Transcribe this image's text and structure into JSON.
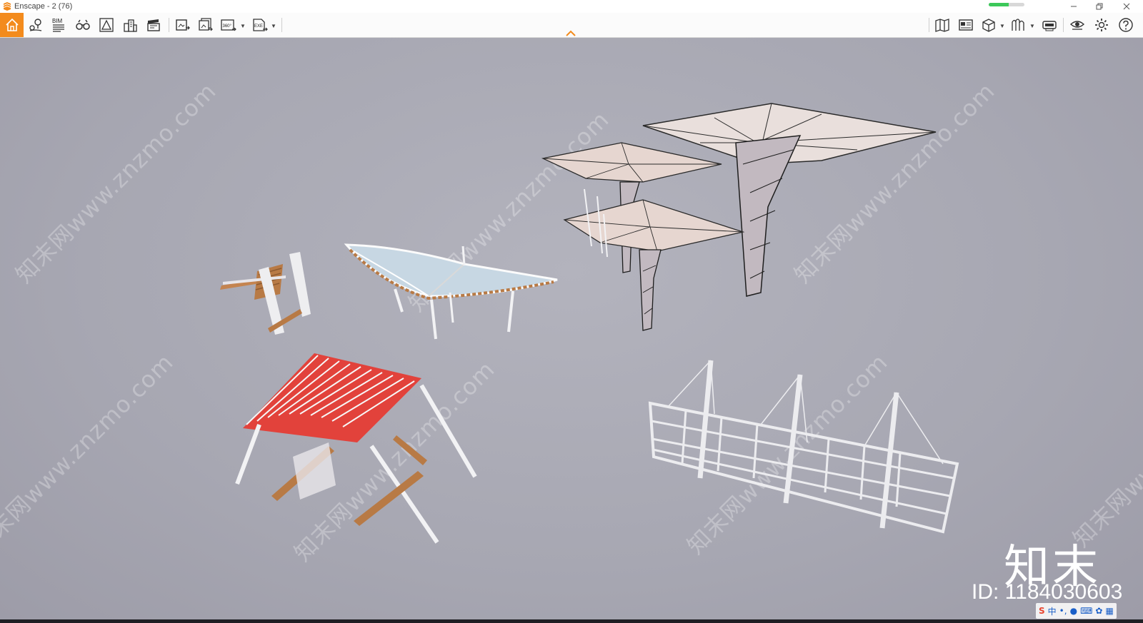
{
  "window": {
    "title": "Enscape - 2 (76)",
    "loading_progress": 0.55,
    "controls": [
      "minimize-icon",
      "restore-icon",
      "close-icon"
    ]
  },
  "toolbar": {
    "bim_label": "BIM",
    "panorama_label": "360°",
    "exe_label": "EXE",
    "accent_color": "#f38b1d",
    "left_icons": [
      "home-icon",
      "location-pin-icon",
      "bim-icon",
      "binoculars-icon",
      "perspective-icon",
      "buildings-icon",
      "clapper-icon"
    ],
    "export_icons": [
      "screenshot-export-icon",
      "batch-export-icon",
      "panorama-icon",
      "exe-export-icon"
    ],
    "right_icons": [
      "map-icon",
      "views-manager-icon",
      "asset-box-icon",
      "asset-library-icon",
      "vr-headset-icon",
      "visibility-eye-icon",
      "settings-gear-icon",
      "help-icon"
    ]
  },
  "viewport": {
    "watermark_text": "知末网www.znzmo.com",
    "brand_mark": "知末",
    "id_label": "ID: 1184030603",
    "roof_color": "#e8362e",
    "wood_color": "#b87a45"
  },
  "tray": {
    "ime_label": "S",
    "lang_label": "中"
  }
}
